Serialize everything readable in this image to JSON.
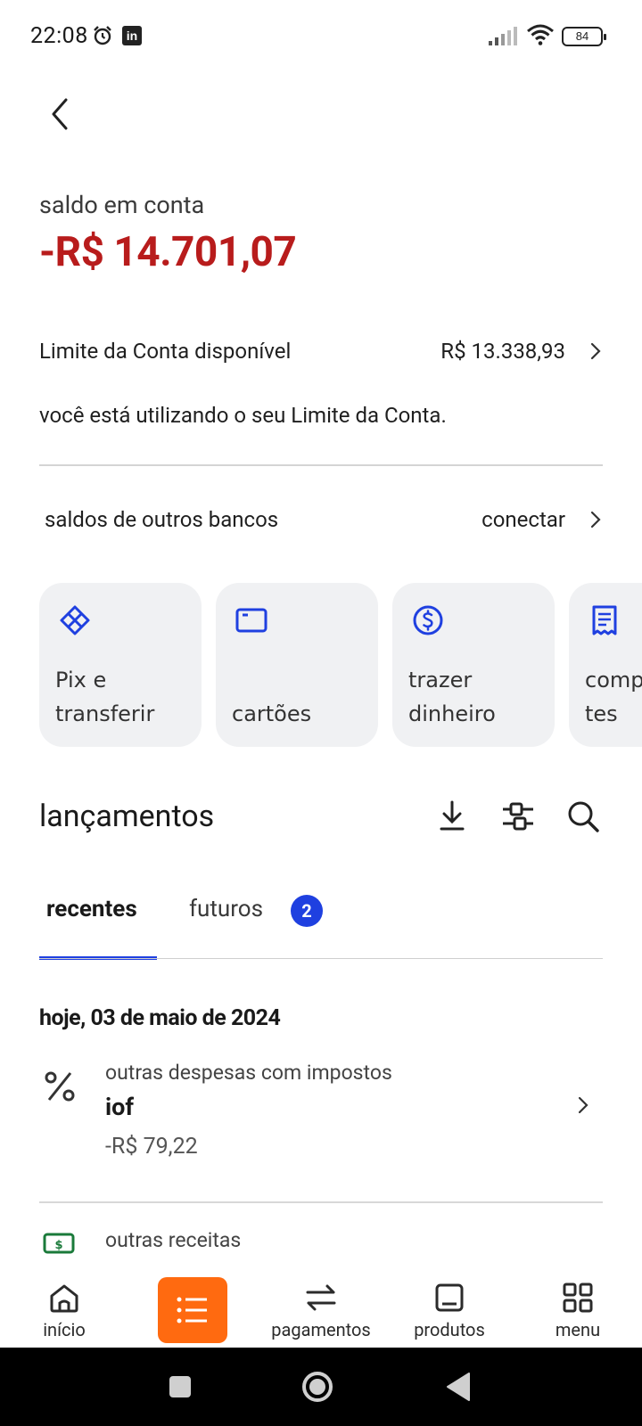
{
  "status_bar": {
    "time": "22:08",
    "battery": "84",
    "linkedin": "in"
  },
  "account": {
    "balance_label": "saldo em conta",
    "balance_value": "-R$ 14.701,07",
    "limit_label": "Limite da Conta disponível",
    "limit_value": "R$ 13.338,93",
    "limit_warning": "você está utilizando o seu Limite da Conta.",
    "other_banks_label": "saldos de outros bancos",
    "other_banks_action": "conectar"
  },
  "quick_actions": [
    {
      "label": "Pix e\ntransferir",
      "icon": "pix-icon"
    },
    {
      "label": "cartões",
      "icon": "card-icon"
    },
    {
      "label": "trazer\ndinheiro",
      "icon": "dollar-coin-icon"
    },
    {
      "label": "comp\ntes",
      "icon": "receipt-icon"
    }
  ],
  "transactions": {
    "title": "lançamentos",
    "tools": [
      "download-icon",
      "filter-icon",
      "search-icon"
    ],
    "tabs": {
      "recent": "recentes",
      "future": "futuros",
      "future_badge": "2"
    },
    "date_header": "hoje, 03 de maio de 2024",
    "items": [
      {
        "category": "outras despesas com impostos",
        "name": "iof",
        "amount": "-R$ 79,22",
        "icon": "percent-icon"
      },
      {
        "category": "outras receitas",
        "icon": "cash-icon"
      }
    ]
  },
  "bottom_nav": [
    {
      "label": "início",
      "icon": "home-icon"
    },
    {
      "label": "",
      "icon": "list-icon",
      "active": true
    },
    {
      "label": "pagamentos",
      "icon": "transfer-arrows-icon"
    },
    {
      "label": "produtos",
      "icon": "device-icon"
    },
    {
      "label": "menu",
      "icon": "grid-icon"
    }
  ],
  "colors": {
    "negative": "#b81c1c",
    "accent": "#1f40e0",
    "nav_active": "#ff6a10",
    "card_bg": "#f0f1f3"
  }
}
